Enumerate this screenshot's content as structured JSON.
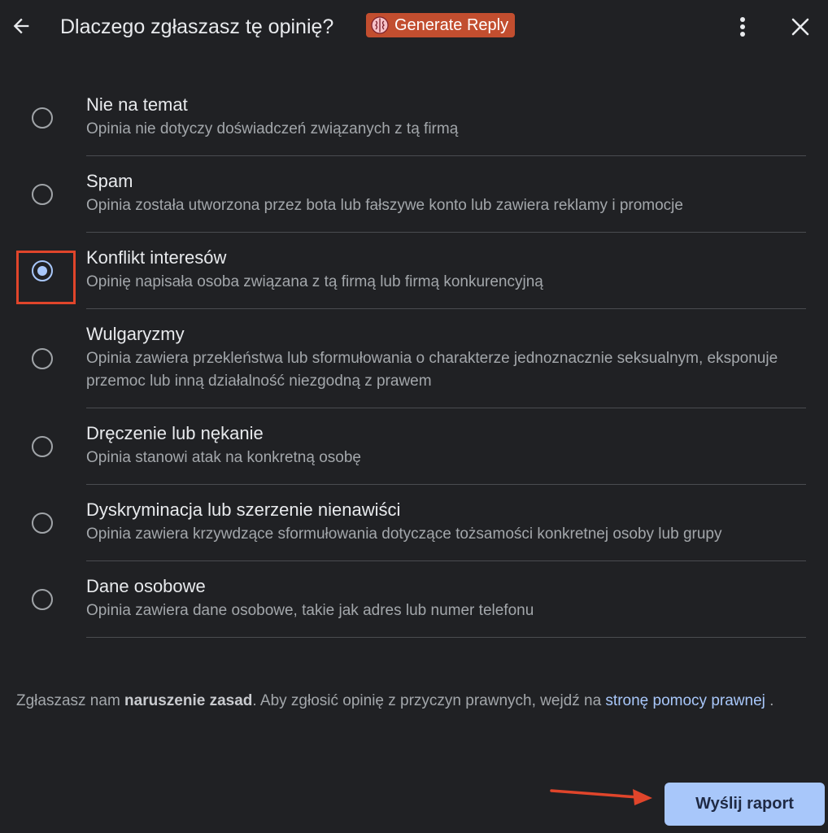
{
  "header": {
    "title": "Dlaczego zgłaszasz tę opinię?",
    "generate_reply_label": "Generate Reply",
    "icons": {
      "back": "arrow-left-icon",
      "generate": "brain-icon",
      "more": "more-vert-icon",
      "close": "close-icon"
    }
  },
  "options": [
    {
      "title": "Nie na temat",
      "description": "Opinia nie dotyczy doświadczeń związanych z tą firmą",
      "checked": false
    },
    {
      "title": "Spam",
      "description": "Opinia została utworzona przez bota lub fałszywe konto lub zawiera reklamy i promocje",
      "checked": false
    },
    {
      "title": "Konflikt interesów",
      "description": "Opinię napisała osoba związana z tą firmą lub firmą konkurencyjną",
      "checked": true
    },
    {
      "title": "Wulgaryzmy",
      "description": "Opinia zawiera przekleństwa lub sformułowania o charakterze jednoznacznie seksualnym, eksponuje przemoc lub inną działalność niezgodną z prawem",
      "checked": false
    },
    {
      "title": "Dręczenie lub nękanie",
      "description": "Opinia stanowi atak na konkretną osobę",
      "checked": false
    },
    {
      "title": "Dyskryminacja lub szerzenie nienawiści",
      "description": "Opinia zawiera krzywdzące sformułowania dotyczące tożsamości konkretnej osoby lub grupy",
      "checked": false
    },
    {
      "title": "Dane osobowe",
      "description": "Opinia zawiera dane osobowe, takie jak adres lub numer telefonu",
      "checked": false
    }
  ],
  "footer": {
    "text_before": "Zgłaszasz nam ",
    "bold": "naruszenie zasad",
    "text_middle": ". Aby zgłosić opinię z przyczyn prawnych, wejdź na ",
    "link": "stronę pomocy prawnej",
    "text_after": " ."
  },
  "submit_label": "Wyślij raport",
  "colors": {
    "background": "#202124",
    "accent": "#a8c7fa",
    "generate_button": "#c24e2f",
    "annotation_red": "#e0452b"
  }
}
